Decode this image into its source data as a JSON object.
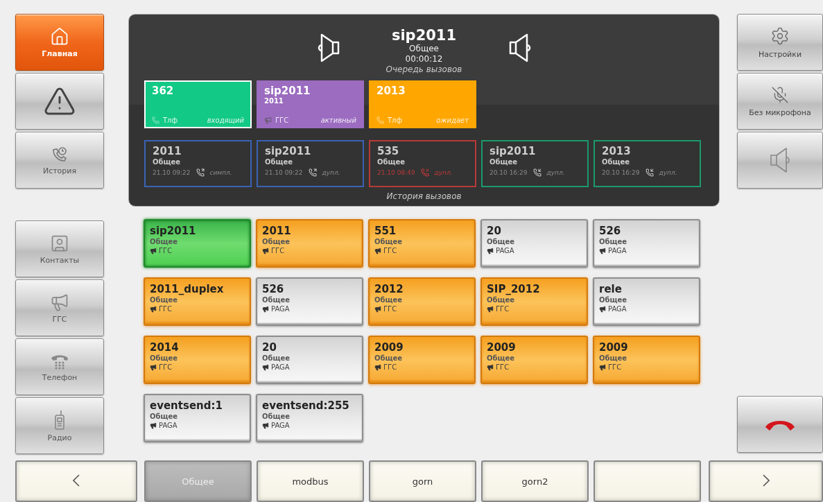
{
  "nav": [
    {
      "label": "Главная",
      "selected": true
    },
    {
      "selected": false
    },
    {
      "label": "История",
      "selected": false
    },
    {
      "label": "Контакты",
      "selected": false
    },
    {
      "label": "ГГС",
      "selected": false
    },
    {
      "label": "Телефон",
      "selected": false
    },
    {
      "label": "Радио",
      "selected": false
    }
  ],
  "current_call": {
    "name": "sip2011",
    "group": "Общее",
    "duration": "00:00:12"
  },
  "queue_title": "Очередь вызовов",
  "queue": [
    {
      "name": "362",
      "kind": "phone",
      "type": "Тлф",
      "status": "входящий",
      "color": "#12c985",
      "selected": true
    },
    {
      "name": "sip2011",
      "number": "2011",
      "kind": "ggs",
      "type": "ГГС",
      "status": "активный",
      "color": "#9b6cc0",
      "selected": false
    },
    {
      "name": "2013",
      "kind": "phone",
      "type": "Тлф",
      "status": "ожидает",
      "color": "#ffa600",
      "selected": false
    }
  ],
  "history": [
    {
      "name": "2011",
      "group": "Общее",
      "time": "21.10 09:22",
      "kind": "outgoing",
      "mode": "симпл.",
      "color": "#3a63b5"
    },
    {
      "name": "sip2011",
      "group": "Общее",
      "time": "21.10 09:22",
      "kind": "outgoing",
      "mode": "дупл.",
      "color": "#3a63b5"
    },
    {
      "name": "535",
      "group": "Общее",
      "time": "21.10 08:49",
      "kind": "missed",
      "mode": "дупл.",
      "color": "#b83a3a"
    },
    {
      "name": "sip2011",
      "group": "Общее",
      "time": "20.10 16:29",
      "kind": "incoming",
      "mode": "дупл.",
      "color": "#1b9a6c"
    },
    {
      "name": "2013",
      "group": "Общее",
      "time": "20.10 16:29",
      "kind": "incoming",
      "mode": "дупл.",
      "color": "#1b9a6c"
    }
  ],
  "history_title": "История вызовов",
  "tools": [
    {
      "label": "Настройки"
    },
    {
      "label": "Без микрофона"
    }
  ],
  "tiles": [
    {
      "name": "sip2011",
      "group": "Общее",
      "type": "ГГС",
      "kind": "active"
    },
    {
      "name": "2011",
      "group": "Общее",
      "type": "ГГС",
      "kind": "busy"
    },
    {
      "name": "551",
      "group": "Общее",
      "type": "ГГС",
      "kind": "busy"
    },
    {
      "name": "20",
      "group": "Общее",
      "type": "PAGA",
      "kind": "idle"
    },
    {
      "name": "526",
      "group": "Общее",
      "type": "PAGA",
      "kind": "idle"
    },
    {
      "name": "2011_duplex",
      "group": "Общее",
      "type": "ГГС",
      "kind": "busy"
    },
    {
      "name": "526",
      "group": "Общее",
      "type": "PAGA",
      "kind": "idle"
    },
    {
      "name": "2012",
      "group": "Общее",
      "type": "ГГС",
      "kind": "busy"
    },
    {
      "name": "SIP_2012",
      "group": "Общее",
      "type": "ГГС",
      "kind": "busy"
    },
    {
      "name": "rele",
      "group": "Общее",
      "type": "PAGA",
      "kind": "idle"
    },
    {
      "name": "2014",
      "group": "Общее",
      "type": "ГГС",
      "kind": "busy"
    },
    {
      "name": "20",
      "group": "Общее",
      "type": "PAGA",
      "kind": "idle"
    },
    {
      "name": "2009",
      "group": "Общее",
      "type": "ГГС",
      "kind": "busy"
    },
    {
      "name": "2009",
      "group": "Общее",
      "type": "ГГС",
      "kind": "busy"
    },
    {
      "name": "2009",
      "group": "Общее",
      "type": "ГГС",
      "kind": "busy"
    },
    {
      "name": "eventsend:1",
      "group": "Общее",
      "type": "PAGA",
      "kind": "idle"
    },
    {
      "name": "eventsend:255",
      "group": "Общее",
      "type": "PAGA",
      "kind": "idle"
    }
  ],
  "groups": [
    {
      "label": "Общее",
      "selected": true
    },
    {
      "label": "modbus",
      "selected": false
    },
    {
      "label": "gorn",
      "selected": false
    },
    {
      "label": "gorn2",
      "selected": false
    },
    {
      "selected": false
    }
  ]
}
